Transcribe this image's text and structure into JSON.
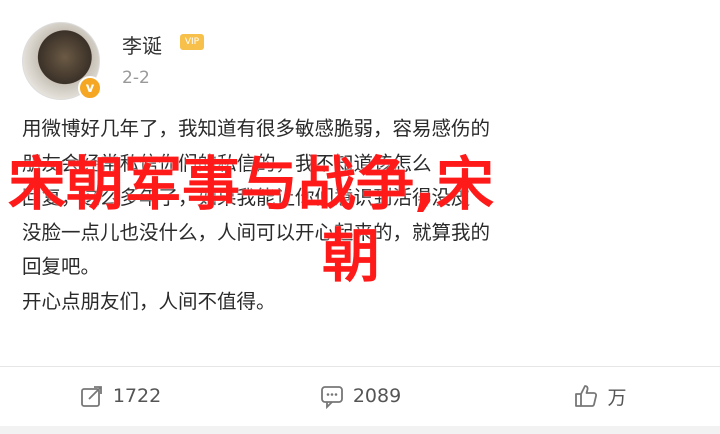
{
  "post": {
    "username": "李诞",
    "vip_badge": "VIP",
    "time": "2-2",
    "lines": [
      "用微博好几年了，我知道有很多敏感脆弱，容易感伤的",
      "朋友会经常私信你们的私信的，我不知道该怎么",
      "回复，这么多年了，如果我能让你们意识到活得没皮",
      "没脸一点儿也没什么，人间可以开心起来的，就算我的",
      "回复吧。",
      "开心点朋友们，人间不值得。"
    ]
  },
  "overlay": {
    "line1": "宋朝军事与战争,宋",
    "line2": "朝",
    "color": "#ff1a1a"
  },
  "actions": {
    "share_count": "1722",
    "comment_count": "2089",
    "like_count": "万"
  }
}
